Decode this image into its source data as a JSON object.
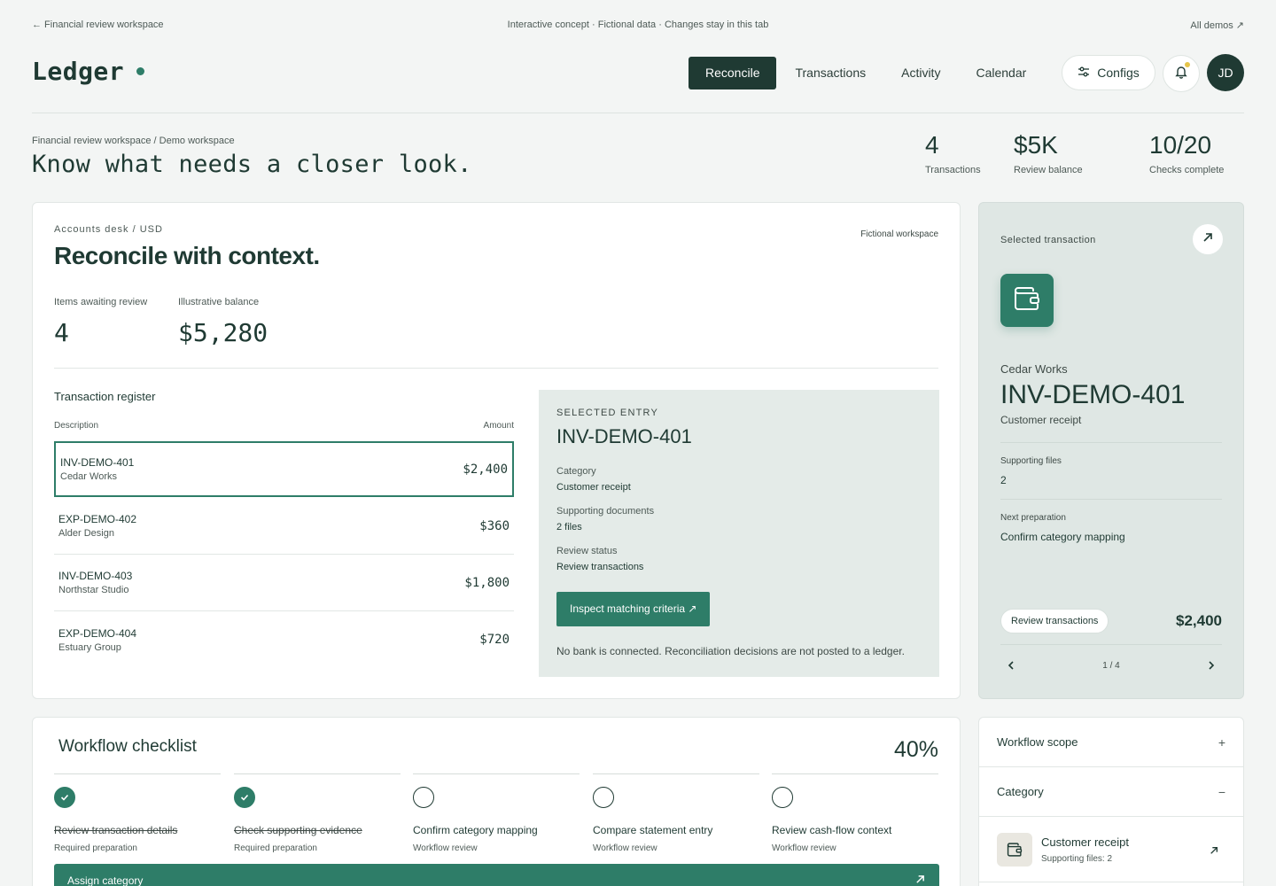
{
  "topbar": {
    "back": "← Financial review workspace",
    "notice": "Interactive concept · Fictional data · Changes stay in this tab",
    "all_demos": "All demos ↗"
  },
  "brand": {
    "name": "Ledger"
  },
  "nav": {
    "tabs": [
      {
        "label": "Reconcile",
        "active": true
      },
      {
        "label": "Transactions",
        "active": false
      },
      {
        "label": "Activity",
        "active": false
      },
      {
        "label": "Calendar",
        "active": false
      }
    ],
    "configs_label": "Configs",
    "avatar_initials": "JD"
  },
  "hero": {
    "breadcrumb": "Financial review workspace / Demo workspace",
    "title": "Know what needs a closer look.",
    "stats": [
      {
        "value": "4",
        "label": "Transactions"
      },
      {
        "value": "$5K",
        "label": "Review balance"
      },
      {
        "value": "10/20",
        "label": "Checks complete"
      }
    ]
  },
  "main": {
    "eyebrow": "Accounts desk / USD",
    "badge": "Fictional workspace",
    "title": "Reconcile with context.",
    "metrics": [
      {
        "label": "Items awaiting review",
        "value": "4"
      },
      {
        "label": "Illustrative balance",
        "value": "$5,280"
      }
    ],
    "register": {
      "title": "Transaction register",
      "col_description": "Description",
      "col_amount": "Amount",
      "rows": [
        {
          "id": "INV-DEMO-401",
          "vendor": "Cedar Works",
          "amount": "$2,400",
          "selected": true
        },
        {
          "id": "EXP-DEMO-402",
          "vendor": "Alder Design",
          "amount": "$360",
          "selected": false
        },
        {
          "id": "INV-DEMO-403",
          "vendor": "Northstar Studio",
          "amount": "$1,800",
          "selected": false
        },
        {
          "id": "EXP-DEMO-404",
          "vendor": "Estuary Group",
          "amount": "$720",
          "selected": false
        }
      ]
    },
    "entry": {
      "label": "SELECTED ENTRY",
      "id": "INV-DEMO-401",
      "fields": [
        {
          "key": "Category",
          "value": "Customer receipt"
        },
        {
          "key": "Supporting documents",
          "value": "2 files"
        },
        {
          "key": "Review status",
          "value": "Review transactions"
        }
      ],
      "button": "Inspect matching criteria ↗",
      "note": "No bank is connected. Reconciliation decisions are not posted to a ledger."
    }
  },
  "side": {
    "label": "Selected transaction",
    "vendor": "Cedar Works",
    "id": "INV-DEMO-401",
    "type": "Customer receipt",
    "files_label": "Supporting files",
    "files_value": "2",
    "next_label": "Next preparation",
    "next_value": "Confirm category mapping",
    "pill": "Review transactions",
    "amount": "$2,400",
    "pager": "1 / 4"
  },
  "checklist": {
    "title": "Workflow checklist",
    "percent": "40%",
    "progress_fraction": 0.4,
    "items": [
      {
        "title": "Review transaction details",
        "sub": "Required preparation",
        "done": true
      },
      {
        "title": "Check supporting evidence",
        "sub": "Required preparation",
        "done": true
      },
      {
        "title": "Confirm category mapping",
        "sub": "Workflow review",
        "done": false
      },
      {
        "title": "Compare statement entry",
        "sub": "Workflow review",
        "done": false
      },
      {
        "title": "Review cash-flow context",
        "sub": "Workflow review",
        "done": false
      }
    ],
    "action": "Assign category"
  },
  "accordion": {
    "scope_label": "Workflow scope",
    "scope_sign": "+",
    "category_label": "Category",
    "category_sign": "−",
    "item_title": "Customer receipt",
    "item_sub": "Supporting files: 2"
  },
  "colors": {
    "accent": "#2e7d68",
    "dark": "#1f3a33",
    "panel": "#e4ebe8",
    "notification": "#e6c54a"
  }
}
